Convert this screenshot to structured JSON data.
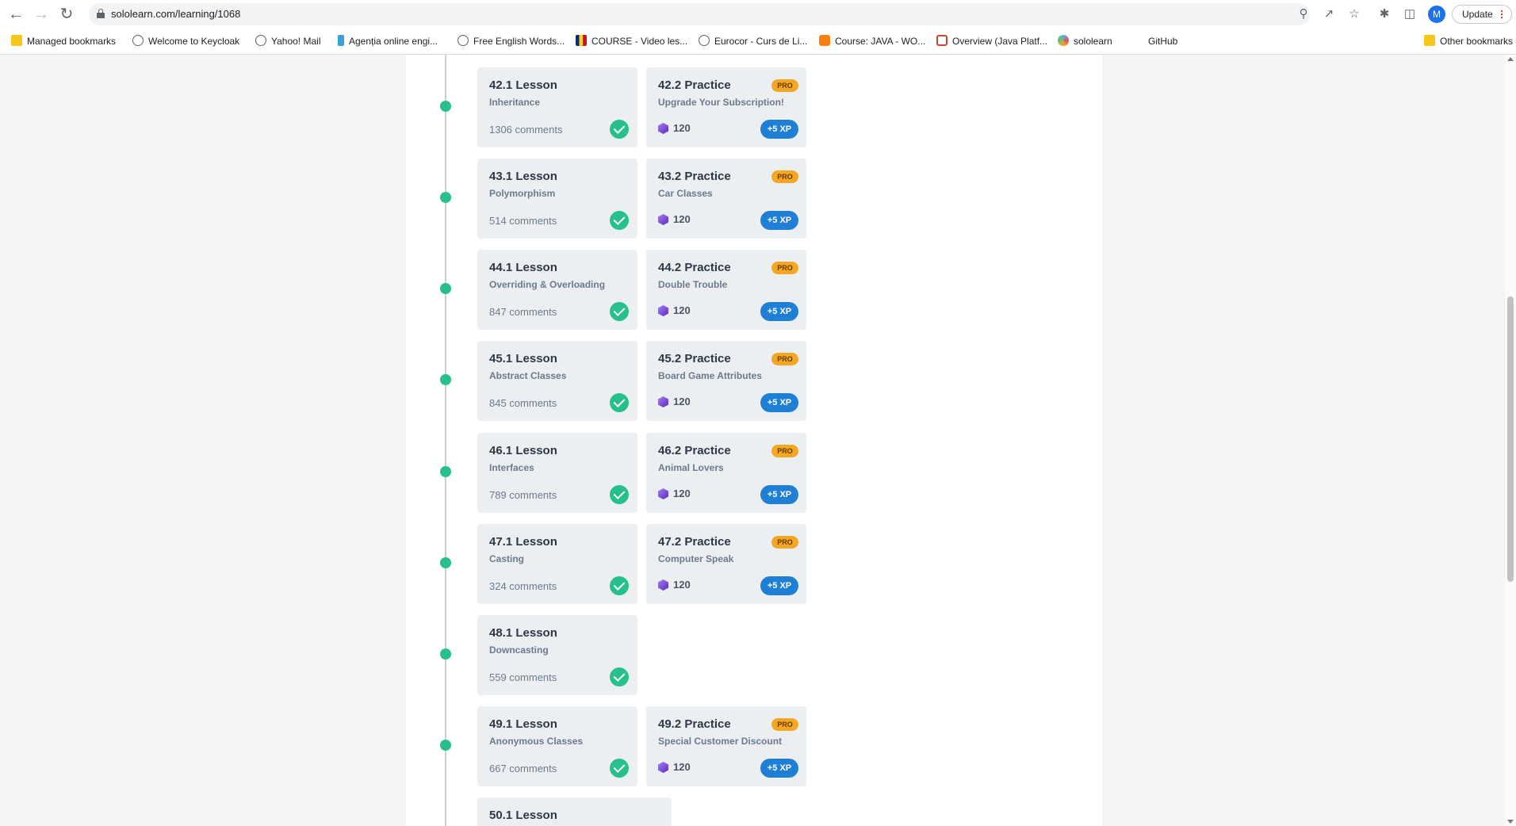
{
  "browser": {
    "url": "sololearn.com/learning/1068",
    "profile_initial": "M",
    "update_label": "Update",
    "update_dots": "⋮"
  },
  "bookmarks": [
    {
      "label": "Managed bookmarks",
      "icon": "folder-icon"
    },
    {
      "label": "Welcome to Keycloak",
      "icon": "globe-icon"
    },
    {
      "label": "Yahoo! Mail",
      "icon": "globe-icon"
    },
    {
      "label": "Agenția online engi...",
      "icon": "site-icon"
    },
    {
      "label": "Free English Words...",
      "icon": "globe-icon"
    },
    {
      "label": "COURSE - Video les...",
      "icon": "flag-icon"
    },
    {
      "label": "Eurocor - Curs de Li...",
      "icon": "globe-icon"
    },
    {
      "label": "Course: JAVA - WO...",
      "icon": "moodle-icon"
    },
    {
      "label": "Overview (Java Platf...",
      "icon": "oracle-icon"
    },
    {
      "label": "sololearn",
      "icon": "sololearn-icon"
    },
    {
      "label": "GitHub",
      "icon": "none"
    },
    {
      "label": "Other bookmarks",
      "icon": "folder-icon"
    }
  ],
  "lessons": [
    {
      "lesson_title": "42.1 Lesson",
      "lesson_sub": "Inheritance",
      "comments": "1306 comments",
      "practice": {
        "title": "42.2 Practice",
        "sub": "Upgrade Your Subscription!",
        "badge": "PRO",
        "gems": "120",
        "xp": "+5 XP"
      }
    },
    {
      "lesson_title": "43.1 Lesson",
      "lesson_sub": "Polymorphism",
      "comments": "514 comments",
      "practice": {
        "title": "43.2 Practice",
        "sub": "Car Classes",
        "badge": "PRO",
        "gems": "120",
        "xp": "+5 XP"
      }
    },
    {
      "lesson_title": "44.1 Lesson",
      "lesson_sub": "Overriding & Overloading",
      "comments": "847 comments",
      "practice": {
        "title": "44.2 Practice",
        "sub": "Double Trouble",
        "badge": "PRO",
        "gems": "120",
        "xp": "+5 XP"
      }
    },
    {
      "lesson_title": "45.1 Lesson",
      "lesson_sub": "Abstract Classes",
      "comments": "845 comments",
      "practice": {
        "title": "45.2 Practice",
        "sub": "Board Game Attributes",
        "badge": "PRO",
        "gems": "120",
        "xp": "+5 XP"
      }
    },
    {
      "lesson_title": "46.1 Lesson",
      "lesson_sub": "Interfaces",
      "comments": "789 comments",
      "practice": {
        "title": "46.2 Practice",
        "sub": "Animal Lovers",
        "badge": "PRO",
        "gems": "120",
        "xp": "+5 XP"
      }
    },
    {
      "lesson_title": "47.1 Lesson",
      "lesson_sub": "Casting",
      "comments": "324 comments",
      "practice": {
        "title": "47.2 Practice",
        "sub": "Computer Speak",
        "badge": "PRO",
        "gems": "120",
        "xp": "+5 XP"
      }
    },
    {
      "lesson_title": "48.1 Lesson",
      "lesson_sub": "Downcasting",
      "comments": "559 comments",
      "practice": null
    },
    {
      "lesson_title": "49.1 Lesson",
      "lesson_sub": "Anonymous Classes",
      "comments": "667 comments",
      "practice": {
        "title": "49.2 Practice",
        "sub": "Special Customer Discount",
        "badge": "PRO",
        "gems": "120",
        "xp": "+5 XP"
      }
    }
  ],
  "partial_lesson": {
    "lesson_title": "50.1 Lesson"
  },
  "colors": {
    "completed": "#27c08b",
    "pro_badge": "#f5a623",
    "xp_badge": "#1f7fd4",
    "card_bg": "#eceff2"
  }
}
